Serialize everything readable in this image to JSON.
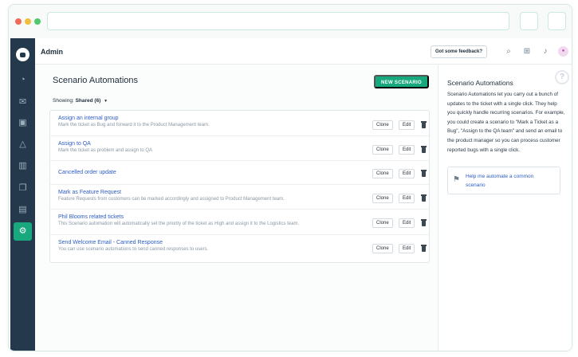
{
  "header": {
    "title": "Admin",
    "feedback_label": "Got some feedback?"
  },
  "main": {
    "title": "Scenario Automations",
    "new_button": "NEW SCENARIO",
    "showing_label": "Showing:",
    "showing_value": "Shared (6)",
    "clone_label": "Clone",
    "edit_label": "Edit",
    "rows": [
      {
        "title": "Assign an internal group",
        "desc": "Mark the ticket as Bug and forward it to the Product Management team."
      },
      {
        "title": "Assign to QA",
        "desc": "Mark the ticket as problem and assign to QA"
      },
      {
        "title": "Cancelled order update",
        "desc": ""
      },
      {
        "title": "Mark as Feature Request",
        "desc": "Feature Requests from customers can be marked accordingly and assigned to Product Management team."
      },
      {
        "title": "Phil Blooms related tickets",
        "desc": "This Scenario automation will automatically set the priority of the ticket as High and assign it to the Logistics team."
      },
      {
        "title": "Send Welcome Email - Canned Response",
        "desc": "You can use scenario automations to send canned responses to users."
      }
    ]
  },
  "panel": {
    "title": "Scenario Automations",
    "text": "Scenario Automations let you carry out a bunch of updates to the ticket with a single click. They help you quickly handle recurring scenarios. For example, you could create a scenario to \"Mark a Ticket as a Bug\", \"Assign to the QA team\" and send an email to the product manager so you can process customer reported bugs with a single click.",
    "help_link": "Help me automate a common scenario"
  },
  "icons": {
    "accent": "#18a87d",
    "nav_bg": "#243a4c",
    "link": "#2c5cc5"
  }
}
